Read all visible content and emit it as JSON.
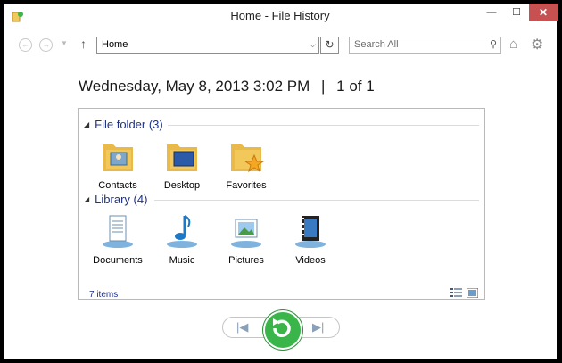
{
  "window": {
    "title": "Home - File History",
    "close_label": "✕",
    "minimize_label": "—",
    "maximize_label": "☐"
  },
  "toolbar": {
    "back_glyph": "←",
    "forward_glyph": "→",
    "dropdown_glyph": "▼",
    "up_glyph": "↑",
    "address_value": "Home",
    "address_dropdown_glyph": "⌵",
    "refresh_glyph": "↻",
    "search_placeholder": "Search All",
    "search_glyph": "⚲",
    "home_glyph": "⌂",
    "settings_glyph": "⚙"
  },
  "snapshot": {
    "date": "Wednesday, May 8, 2013 3:02 PM",
    "separator": "|",
    "position": "1 of 1"
  },
  "groups": [
    {
      "label": "File folder (3)",
      "collapse_glyph": "◢",
      "items": [
        {
          "label": "Contacts",
          "icon": "contacts-folder-icon"
        },
        {
          "label": "Desktop",
          "icon": "desktop-folder-icon"
        },
        {
          "label": "Favorites",
          "icon": "favorites-folder-icon"
        }
      ]
    },
    {
      "label": "Library (4)",
      "collapse_glyph": "◢",
      "items": [
        {
          "label": "Documents",
          "icon": "documents-library-icon"
        },
        {
          "label": "Music",
          "icon": "music-library-icon"
        },
        {
          "label": "Pictures",
          "icon": "pictures-library-icon"
        },
        {
          "label": "Videos",
          "icon": "videos-library-icon"
        }
      ]
    }
  ],
  "status": {
    "item_count": "7 items"
  },
  "playback": {
    "prev_glyph": "|◀",
    "next_glyph": "▶|"
  },
  "colors": {
    "accent_text": "#1e3287",
    "close_button": "#c75050",
    "restore_button": "#39b54a",
    "folder": "#f3c85a"
  }
}
